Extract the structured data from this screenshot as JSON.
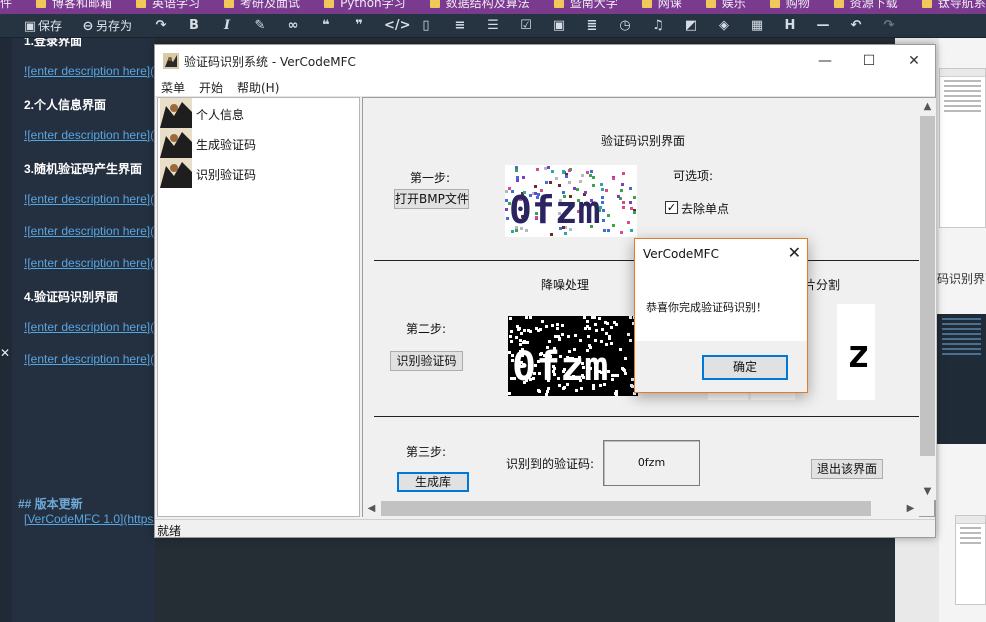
{
  "bookmarks": [
    "件",
    "博客和邮箱",
    "英语学习",
    "考研及面试",
    "Python学习",
    "数据结构及算法",
    "暨南大学",
    "网课",
    "娱乐",
    "购物",
    "资源下载",
    "钛导航系"
  ],
  "toolbar": {
    "save_label": "保存",
    "save_as_label": "另存为"
  },
  "editor": {
    "lines": [
      {
        "text": "1.登录界面",
        "type": "heading"
      },
      {
        "text": "![enter description here](",
        "type": "link"
      },
      {
        "text": "2.个人信息界面",
        "type": "heading"
      },
      {
        "text": "![enter description here](",
        "type": "link"
      },
      {
        "text": "3.随机验证码产生界面",
        "type": "heading"
      },
      {
        "text": "![enter description here](",
        "type": "link"
      },
      {
        "text": "![enter description here](",
        "type": "link"
      },
      {
        "text": "![enter description here](",
        "type": "link"
      },
      {
        "text": "4.验证码识别界面",
        "type": "heading"
      },
      {
        "text": "![enter description here](",
        "type": "link"
      },
      {
        "text": "![enter description here](",
        "type": "link"
      },
      {
        "text": "## 版本更新",
        "type": "version"
      },
      {
        "text": "[VerCodeMFC 1.0](https:",
        "type": "link"
      }
    ]
  },
  "preview": {
    "caption": "码识别界面"
  },
  "window": {
    "title": "验证码识别系统 - VerCodeMFC",
    "menus": [
      "菜单",
      "开始",
      "帮助(H)"
    ],
    "tree": [
      "个人信息",
      "生成验证码",
      "识别验证码"
    ],
    "heading": "验证码识别界面",
    "step1_label": "第一步:",
    "open_bmp_button": "打开BMP文件",
    "options_label": "可选项:",
    "remove_single_point_checkbox": "去除单点",
    "remove_single_point_checked": true,
    "denoise_label": "降噪处理",
    "segment_label": "片分割",
    "step2_label": "第二步:",
    "recognize_button": "识别验证码",
    "step3_label": "第三步:",
    "generate_library_button": "生成库",
    "result_label": "识别到的验证码:",
    "result_value": "0fzm",
    "exit_button": "退出该界面",
    "status": "就绪",
    "captcha_text": "0fzm",
    "segment_char": "z"
  },
  "dialog": {
    "title": "VerCodeMFC",
    "message": "恭喜你完成验证码识别！",
    "ok_button": "确定"
  }
}
